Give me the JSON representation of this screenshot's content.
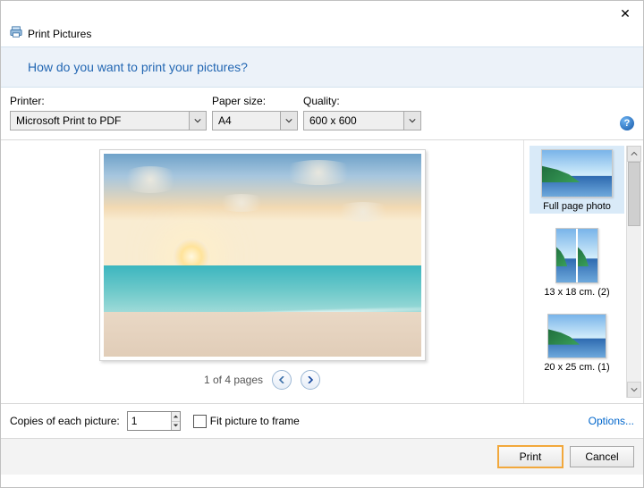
{
  "window": {
    "title": "Print Pictures",
    "close_glyph": "✕"
  },
  "header": {
    "question": "How do you want to print your pictures?"
  },
  "labels": {
    "printer": "Printer:",
    "paper_size": "Paper size:",
    "quality": "Quality:",
    "help_glyph": "?"
  },
  "selections": {
    "printer": "Microsoft Print to PDF",
    "paper_size": "A4",
    "quality": "600 x 600"
  },
  "pager": {
    "text": "1 of 4 pages"
  },
  "layouts": [
    {
      "label": "Full page photo",
      "selected": true,
      "kind": "full"
    },
    {
      "label": "13 x 18 cm. (2)",
      "selected": false,
      "kind": "split"
    },
    {
      "label": "20 x 25 cm. (1)",
      "selected": false,
      "kind": "single"
    }
  ],
  "bottom": {
    "copies_label": "Copies of each picture:",
    "copies_value": "1",
    "fit_label": "Fit picture to frame",
    "fit_checked": false,
    "options_link": "Options...",
    "print_label": "Print",
    "cancel_label": "Cancel"
  }
}
